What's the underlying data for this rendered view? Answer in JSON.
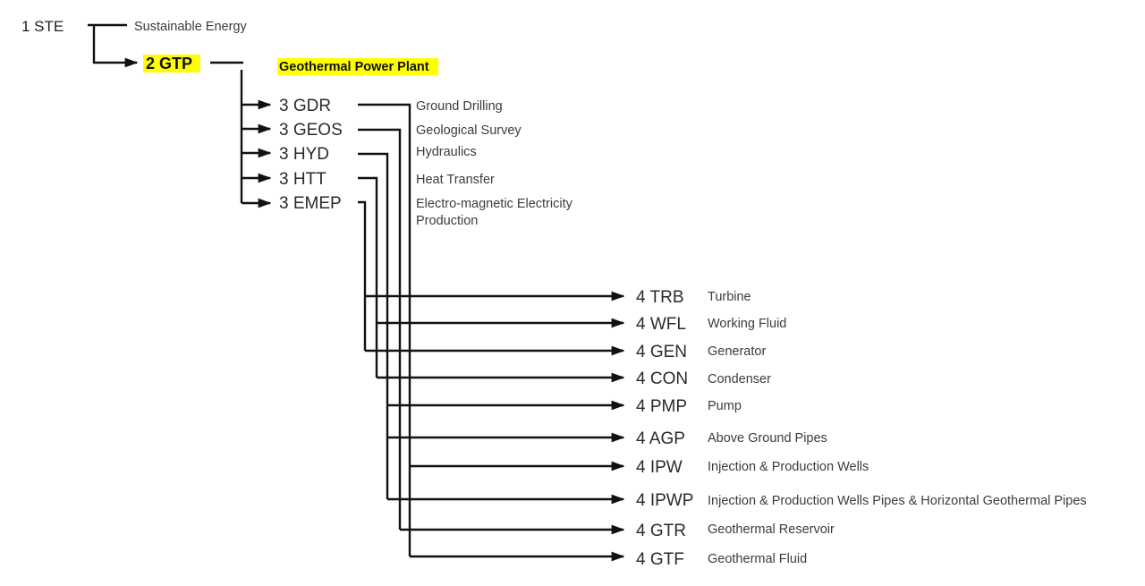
{
  "diagram": {
    "title_text": "Geothermal Power Plant system decomposition tree",
    "highlight_color": "#ffff00",
    "line_color": "#111111",
    "nodes": {
      "level1": {
        "code": "1 STE",
        "label": "Sustainable Energy",
        "highlighted": false
      },
      "level2": {
        "code": "2 GTP",
        "label": "Geothermal Power Plant",
        "highlighted": true
      },
      "level3": [
        {
          "code": "3 GDR",
          "label": "Ground Drilling"
        },
        {
          "code": "3 GEOS",
          "label": "Geological Survey"
        },
        {
          "code": "3 HYD",
          "label": "Hydraulics"
        },
        {
          "code": "3 HTT",
          "label": "Heat Transfer"
        },
        {
          "code": "3 EMEP",
          "label": "Electro-magnetic Electricity"
        },
        {
          "code": "",
          "label": "Production"
        }
      ],
      "level4": [
        {
          "code": "4 TRB",
          "label": "Turbine"
        },
        {
          "code": "4 WFL",
          "label": "Working Fluid"
        },
        {
          "code": "4 GEN",
          "label": "Generator"
        },
        {
          "code": "4 CON",
          "label": "Condenser"
        },
        {
          "code": "4 PMP",
          "label": "Pump"
        },
        {
          "code": "4 AGP",
          "label": "Above Ground Pipes"
        },
        {
          "code": "4 IPW",
          "label": "Injection & Production Wells"
        },
        {
          "code": "4 IPWP",
          "label": "Injection & Production Wells Pipes &  Horizontal Geothermal Pipes"
        },
        {
          "code": "4 GTR",
          "label": "Geothermal Reservoir"
        },
        {
          "code": "4 GTF",
          "label": "Geothermal Fluid"
        }
      ]
    }
  }
}
